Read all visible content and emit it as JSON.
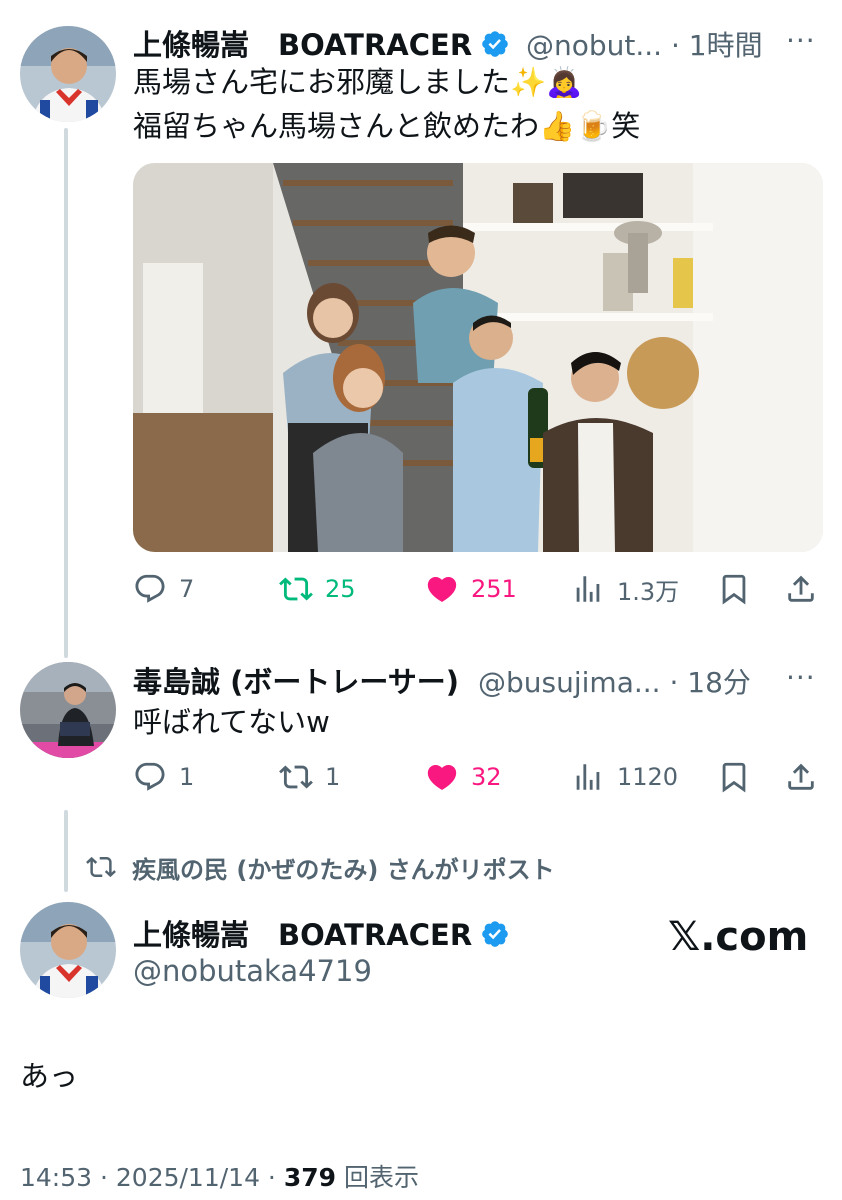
{
  "tweet1": {
    "display_name": "上條暢嵩　BOATRACER",
    "handle_time": "@nobut... · 1時間",
    "more": "···",
    "text_line1": "馬場さん宅にお邪魔しました✨🙇‍♀️",
    "text_line2": "福留ちゃん馬場さんと飲めたわ👍🍺笑",
    "image_alt": "Group photo of six people posing by a staircase with trophies",
    "actions": {
      "replies": "7",
      "reposts": "25",
      "likes": "251",
      "views": "1.3万"
    }
  },
  "tweet2": {
    "display_name": "毒島誠 (ボートレーサー)",
    "handle_time": "@busujima... · 18分",
    "more": "···",
    "text": "呼ばれてないw",
    "actions": {
      "replies": "1",
      "reposts": "1",
      "likes": "32",
      "views": "1120"
    }
  },
  "repost_banner": {
    "text": "疾風の民 (かぜのたみ) さんがリポスト"
  },
  "tweet3": {
    "display_name": "上條暢嵩　BOATRACER",
    "handle": "@nobutaka4719",
    "logo_text": "𝕏.com",
    "text": "あっ",
    "timestamp": "14:53 · 2025/11/14 · ",
    "view_count": "379",
    "view_label": " 回表示"
  },
  "colors": {
    "text": "#0f1419",
    "secondary": "#536471",
    "verified": "#1d9bf0",
    "repost_green": "#00ba7c",
    "like_pink": "#f91880"
  },
  "icons": [
    "reply-icon",
    "repost-icon",
    "like-icon",
    "views-icon",
    "bookmark-icon",
    "share-icon",
    "verified-badge-icon"
  ]
}
